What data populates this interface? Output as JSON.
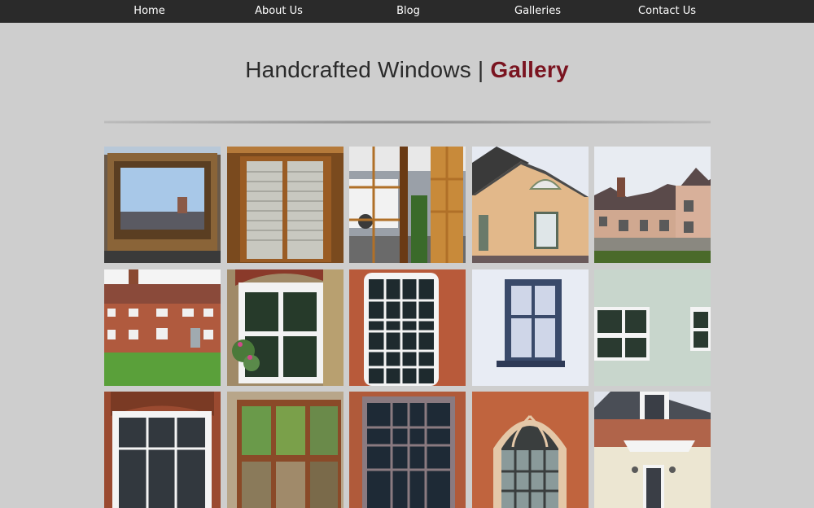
{
  "nav": {
    "items": [
      {
        "label": "Home"
      },
      {
        "label": "About Us"
      },
      {
        "label": "Blog"
      },
      {
        "label": "Galleries"
      },
      {
        "label": "Contact Us"
      }
    ]
  },
  "header": {
    "title_main": "Handcrafted Windows | ",
    "title_accent": "Gallery"
  },
  "colors": {
    "nav_background": "#2a2a2a",
    "page_background": "#cecece",
    "accent": "#7a1420"
  },
  "gallery": {
    "thumbnails": [
      {
        "icon": "oak-window-photo"
      },
      {
        "icon": "shuttered-window-photo"
      },
      {
        "icon": "open-door-photo"
      },
      {
        "icon": "cottage-dormer-photo"
      },
      {
        "icon": "farmhouse-photo"
      },
      {
        "icon": "brick-terrace-photo"
      },
      {
        "icon": "sash-window-photo"
      },
      {
        "icon": "georgian-sash-photo"
      },
      {
        "icon": "blue-casement-photo"
      },
      {
        "icon": "white-casement-photo"
      },
      {
        "icon": "arched-brick-window-photo"
      },
      {
        "icon": "timber-casement-photo"
      },
      {
        "icon": "brown-sash-photo"
      },
      {
        "icon": "gothic-arch-window-photo"
      },
      {
        "icon": "render-house-photo"
      }
    ]
  }
}
